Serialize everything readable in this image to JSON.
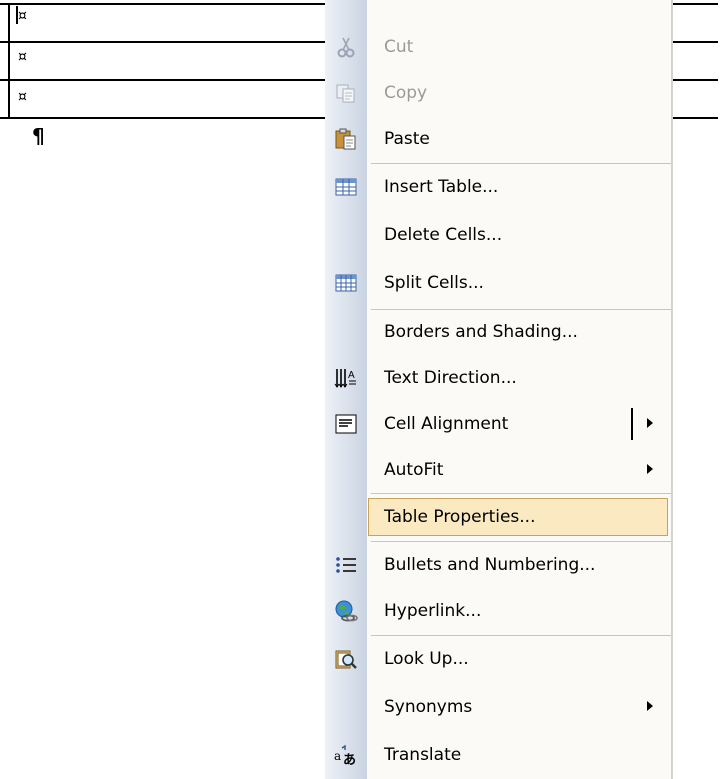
{
  "document": {
    "cell_mark": "¤",
    "paragraph_mark": "¶"
  },
  "context_menu": {
    "items": [
      {
        "label": "Cut",
        "icon": "scissors-icon",
        "enabled": false
      },
      {
        "label": "Copy",
        "icon": "copy-icon",
        "enabled": false
      },
      {
        "label": "Paste",
        "icon": "paste-icon",
        "enabled": true
      },
      {
        "label": "Insert Table...",
        "icon": "insert-table-icon",
        "enabled": true
      },
      {
        "label": "Delete Cells...",
        "icon": "",
        "enabled": true
      },
      {
        "label": "Split Cells...",
        "icon": "split-cells-icon",
        "enabled": true
      },
      {
        "label": "Borders and Shading...",
        "icon": "",
        "enabled": true
      },
      {
        "label": "Text Direction...",
        "icon": "text-direction-icon",
        "enabled": true
      },
      {
        "label": "Cell Alignment",
        "icon": "cell-alignment-icon",
        "enabled": true,
        "submenu": true
      },
      {
        "label": "AutoFit",
        "icon": "",
        "enabled": true,
        "submenu": true
      },
      {
        "label": "Table Properties...",
        "icon": "",
        "enabled": true,
        "highlighted": true
      },
      {
        "label": "Bullets and Numbering...",
        "icon": "bullets-icon",
        "enabled": true
      },
      {
        "label": "Hyperlink...",
        "icon": "hyperlink-globe-icon",
        "enabled": true
      },
      {
        "label": "Look Up...",
        "icon": "look-up-icon",
        "enabled": true
      },
      {
        "label": "Synonyms",
        "icon": "",
        "enabled": true,
        "submenu": true
      },
      {
        "label": "Translate",
        "icon": "translate-icon",
        "enabled": true
      }
    ],
    "colors": {
      "highlight_fill": "#fbe9c2",
      "highlight_border": "#c8a45a",
      "gutter_light": "#eef2f7",
      "gutter_dark": "#c9d3e1",
      "disabled_text": "#9a9a9a"
    }
  }
}
